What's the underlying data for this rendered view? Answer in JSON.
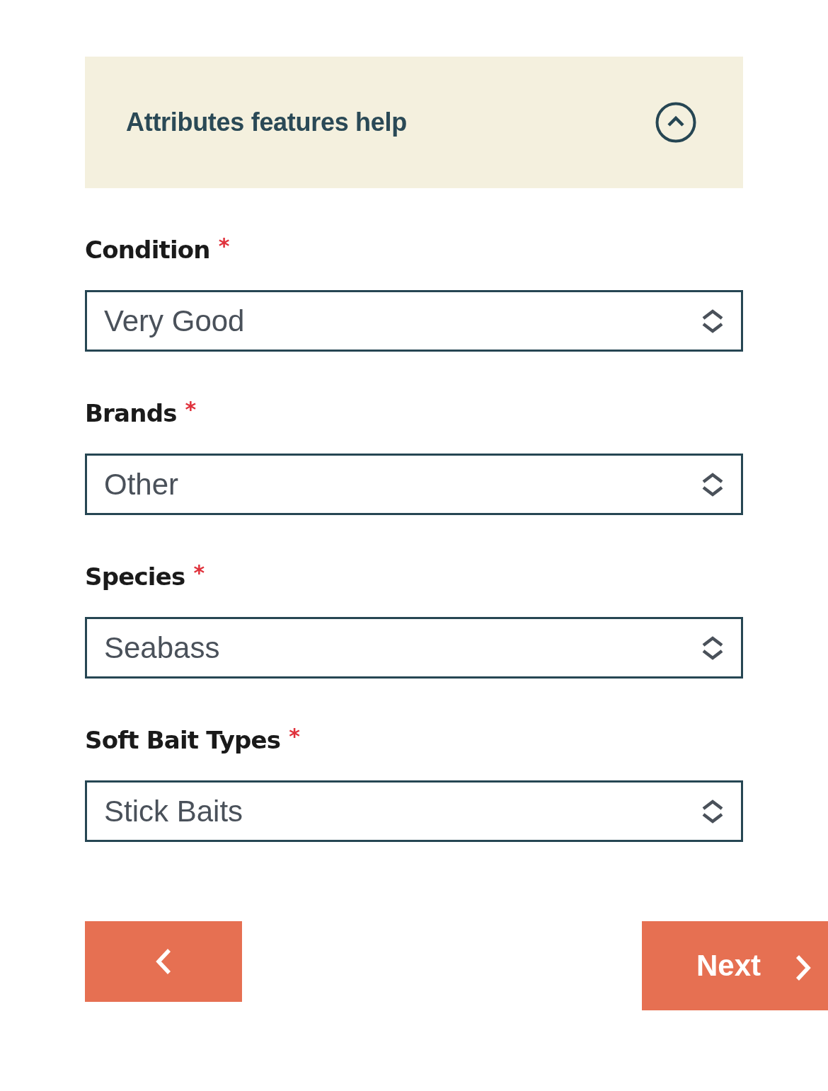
{
  "help_panel": {
    "title": "Attributes features help",
    "expanded": true
  },
  "fields": [
    {
      "label": "Condition",
      "required_mark": "*",
      "value": "Very Good"
    },
    {
      "label": "Brands",
      "required_mark": "*",
      "value": "Other"
    },
    {
      "label": "Species",
      "required_mark": "*",
      "value": "Seabass"
    },
    {
      "label": "Soft Bait Types",
      "required_mark": "*",
      "value": "Stick Baits"
    }
  ],
  "buttons": [
    {
      "kind": "back"
    },
    {
      "kind": "next",
      "label": "Next"
    }
  ]
}
